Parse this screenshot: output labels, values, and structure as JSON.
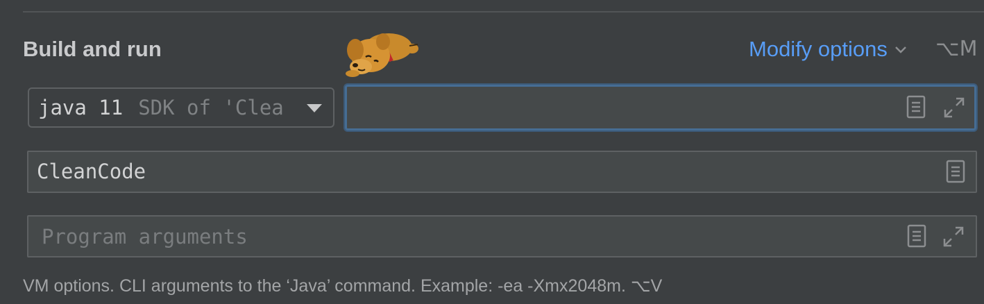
{
  "section": {
    "title": "Build and run"
  },
  "header": {
    "modify_options_label": "Modify options",
    "modify_options_shortcut": "⌥M"
  },
  "jdk_select": {
    "selected_main": "java 11",
    "selected_hint": "SDK of 'Clea"
  },
  "vm_options_field": {
    "value": ""
  },
  "main_class_field": {
    "value": "CleanCode"
  },
  "program_args_field": {
    "value": "",
    "placeholder": "Program arguments"
  },
  "footer": {
    "hint": "VM options. CLI arguments to the ‘Java’ command. Example: -ea -Xmx2048m. ⌥V"
  },
  "icons": {
    "document": "document-icon",
    "expand": "expand-icon",
    "chevron": "chevron-down-icon",
    "mascot": "dog-mascot-icon"
  },
  "colors": {
    "background": "#3c3f41",
    "link": "#589df6",
    "focus_border": "#466d94",
    "text": "#d2d3d4"
  }
}
